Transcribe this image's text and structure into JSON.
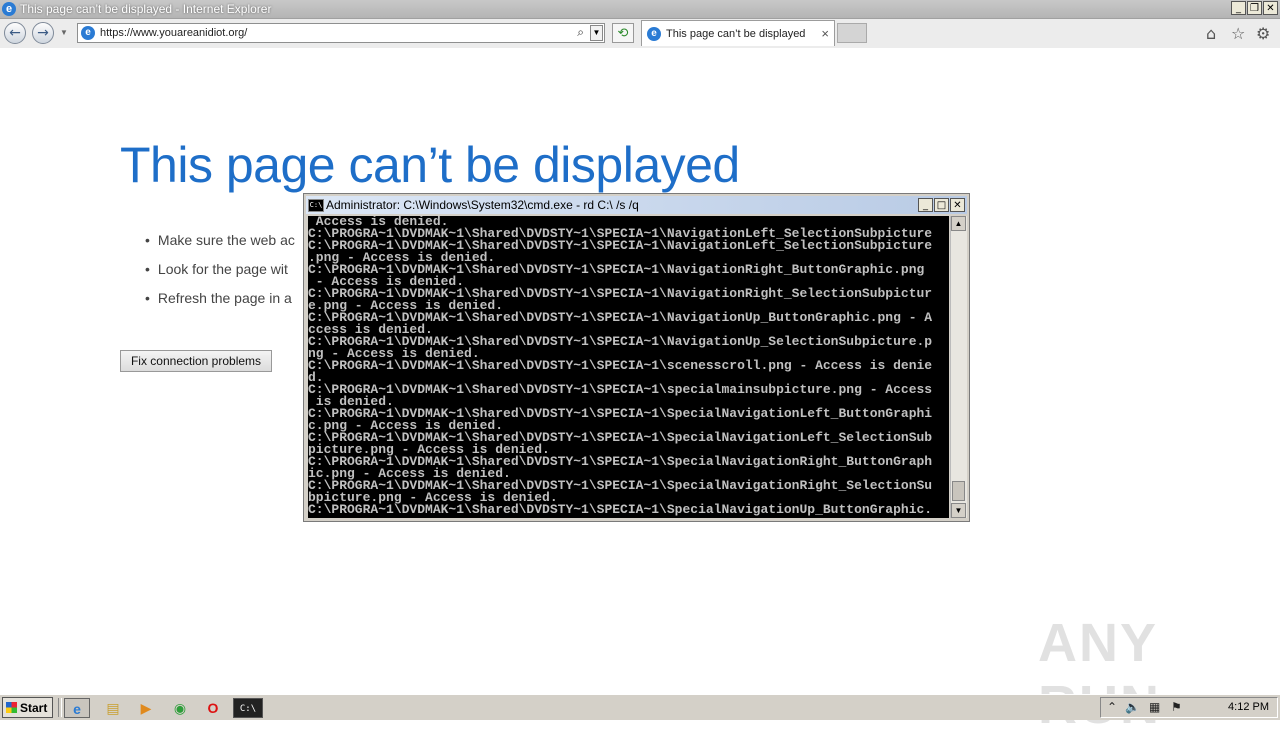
{
  "window": {
    "title": "This page can’t be displayed - Internet Explorer",
    "minimize_glyph": "_",
    "restore_glyph": "❐",
    "close_glyph": "✕"
  },
  "navbar": {
    "back_glyph": "←",
    "forward_glyph": "→",
    "url": "https://www.youareanidiot.org/",
    "search_glyph": "⌕",
    "dropdown_glyph": "▼",
    "refresh_glyph": "⟲",
    "tab_label": "This page can’t be displayed",
    "tab_close_glyph": "×",
    "home_glyph": "⌂",
    "favorites_glyph": "☆",
    "tools_glyph": "⚙"
  },
  "error_page": {
    "title": "This page can’t be displayed",
    "bullets": [
      "Make sure the web ac",
      "Look for the page wit",
      "Refresh the page in a"
    ],
    "fix_button": "Fix connection problems"
  },
  "cmd": {
    "title": "Administrator: C:\\Windows\\System32\\cmd.exe - rd  C:\\ /s /q",
    "icon_text": "C:\\",
    "lines": [
      " Access is denied.",
      "C:\\PROGRA~1\\DVDMAK~1\\Shared\\DVDSTY~1\\SPECIA~1\\NavigationLeft_SelectionSubpicture",
      "C:\\PROGRA~1\\DVDMAK~1\\Shared\\DVDSTY~1\\SPECIA~1\\NavigationLeft_SelectionSubpicture",
      ".png - Access is denied.",
      "C:\\PROGRA~1\\DVDMAK~1\\Shared\\DVDSTY~1\\SPECIA~1\\NavigationRight_ButtonGraphic.png",
      " - Access is denied.",
      "C:\\PROGRA~1\\DVDMAK~1\\Shared\\DVDSTY~1\\SPECIA~1\\NavigationRight_SelectionSubpictur",
      "e.png - Access is denied.",
      "C:\\PROGRA~1\\DVDMAK~1\\Shared\\DVDSTY~1\\SPECIA~1\\NavigationUp_ButtonGraphic.png - A",
      "ccess is denied.",
      "C:\\PROGRA~1\\DVDMAK~1\\Shared\\DVDSTY~1\\SPECIA~1\\NavigationUp_SelectionSubpicture.p",
      "ng - Access is denied.",
      "C:\\PROGRA~1\\DVDMAK~1\\Shared\\DVDSTY~1\\SPECIA~1\\scenesscroll.png - Access is denie",
      "d.",
      "C:\\PROGRA~1\\DVDMAK~1\\Shared\\DVDSTY~1\\SPECIA~1\\specialmainsubpicture.png - Access",
      " is denied.",
      "C:\\PROGRA~1\\DVDMAK~1\\Shared\\DVDSTY~1\\SPECIA~1\\SpecialNavigationLeft_ButtonGraphi",
      "c.png - Access is denied.",
      "C:\\PROGRA~1\\DVDMAK~1\\Shared\\DVDSTY~1\\SPECIA~1\\SpecialNavigationLeft_SelectionSub",
      "picture.png - Access is denied.",
      "C:\\PROGRA~1\\DVDMAK~1\\Shared\\DVDSTY~1\\SPECIA~1\\SpecialNavigationRight_ButtonGraph",
      "ic.png - Access is denied.",
      "C:\\PROGRA~1\\DVDMAK~1\\Shared\\DVDSTY~1\\SPECIA~1\\SpecialNavigationRight_SelectionSu",
      "bpicture.png - Access is denied.",
      "C:\\PROGRA~1\\DVDMAK~1\\Shared\\DVDSTY~1\\SPECIA~1\\SpecialNavigationUp_ButtonGraphic."
    ],
    "scroll_up_glyph": "▲",
    "scroll_down_glyph": "▼"
  },
  "watermark": "ANY RUN",
  "taskbar": {
    "start_label": "Start",
    "pinned": [
      {
        "name": "internet-explorer-icon",
        "glyph": "e"
      },
      {
        "name": "file-explorer-icon",
        "glyph": "▤"
      },
      {
        "name": "media-player-icon",
        "glyph": "▶"
      },
      {
        "name": "chrome-icon",
        "glyph": "◉"
      },
      {
        "name": "opera-icon",
        "glyph": "O"
      },
      {
        "name": "cmd-taskbar-icon",
        "glyph": "C:\\"
      }
    ],
    "tray": {
      "show_hidden_glyph": "⌃",
      "volume_glyph": "🔈",
      "network_glyph": "▦",
      "flag_glyph": "⚑",
      "time": "4:12 PM"
    }
  },
  "colors": {
    "error_title": "#1e6ec8",
    "console_bg": "#000000",
    "console_fg": "#c0c0c0"
  }
}
